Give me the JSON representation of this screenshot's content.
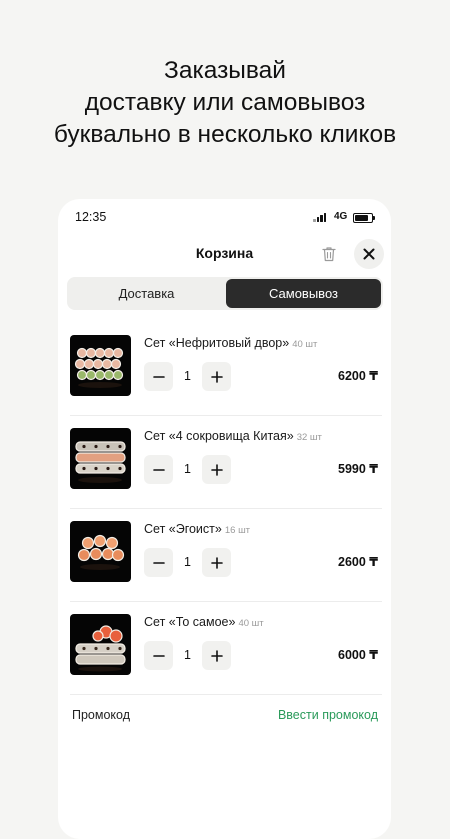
{
  "headline": {
    "line1": "Заказывай",
    "line2": "доставку или самовывоз",
    "line3": "буквально в несколько кликов"
  },
  "status_bar": {
    "time": "12:35",
    "network": "4G"
  },
  "header": {
    "title": "Корзина",
    "icons": [
      "trash-icon",
      "close-icon"
    ]
  },
  "tabs": [
    {
      "label": "Доставка",
      "selected": false
    },
    {
      "label": "Самовывоз",
      "selected": true
    }
  ],
  "items": [
    {
      "name": "Сет «Нефритовый двор»",
      "pieces": "40 шт",
      "count": "1",
      "price": "6200 ₸"
    },
    {
      "name": "Сет «4 сокровища Китая»",
      "pieces": "32 шт",
      "count": "1",
      "price": "5990 ₸"
    },
    {
      "name": "Сет «Эгоист»",
      "pieces": "16 шт",
      "count": "1",
      "price": "2600 ₸"
    },
    {
      "name": "Сет «То самое»",
      "pieces": "40 шт",
      "count": "1",
      "price": "6000 ₸"
    }
  ],
  "promo": {
    "label": "Промокод",
    "link": "Ввести промокод"
  },
  "colors": {
    "accent_green": "#2a9a5a",
    "selected_tab": "#2b2b2b",
    "background": "#f5f5f3"
  }
}
